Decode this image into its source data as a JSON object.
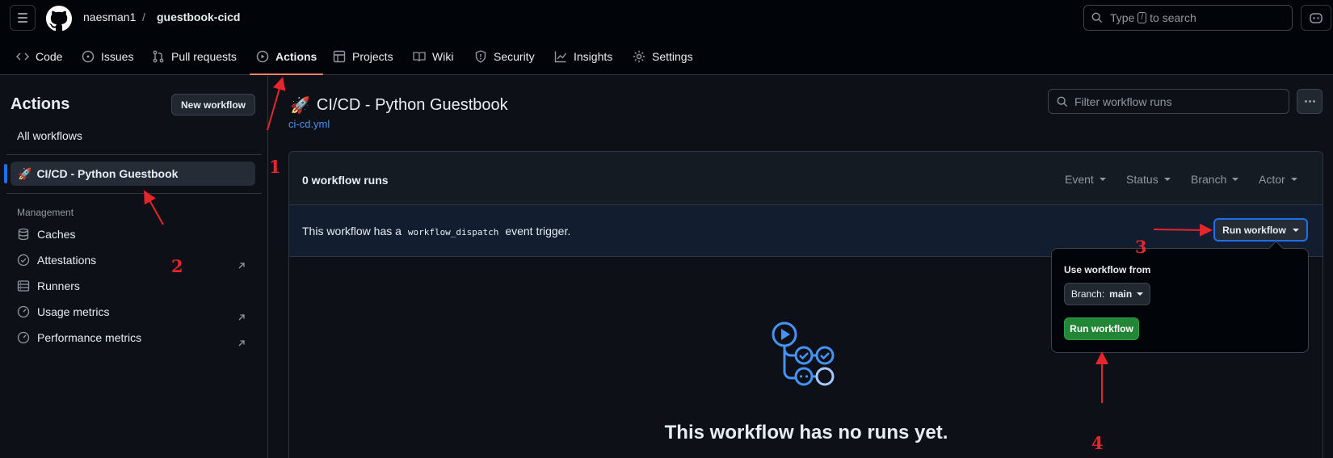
{
  "header": {
    "owner": "naesman1",
    "separator": "/",
    "repo": "guestbook-cicd",
    "search_prefix": "Type",
    "search_key": "/",
    "search_suffix": "to search"
  },
  "tabs": [
    {
      "label": "Code",
      "icon": "code-icon"
    },
    {
      "label": "Issues",
      "icon": "issue-icon"
    },
    {
      "label": "Pull requests",
      "icon": "pull-request-icon"
    },
    {
      "label": "Actions",
      "icon": "play-icon",
      "active": true
    },
    {
      "label": "Projects",
      "icon": "table-icon"
    },
    {
      "label": "Wiki",
      "icon": "book-icon"
    },
    {
      "label": "Security",
      "icon": "shield-icon"
    },
    {
      "label": "Insights",
      "icon": "graph-icon"
    },
    {
      "label": "Settings",
      "icon": "gear-icon"
    }
  ],
  "sidebar": {
    "title": "Actions",
    "new_workflow": "New workflow",
    "all_workflows": "All workflows",
    "workflow_emoji": "🚀",
    "workflow_name": "CI/CD - Python Guestbook",
    "management_heading": "Management",
    "links": [
      {
        "label": "Caches",
        "icon": "database-icon"
      },
      {
        "label": "Attestations",
        "icon": "verified-icon",
        "external": true
      },
      {
        "label": "Runners",
        "icon": "server-icon"
      },
      {
        "label": "Usage metrics",
        "icon": "meter-icon",
        "external": true
      },
      {
        "label": "Performance metrics",
        "icon": "meter-icon",
        "external": true
      }
    ]
  },
  "main": {
    "title_emoji": "🚀",
    "title": "CI/CD - Python Guestbook",
    "file": "ci-cd.yml",
    "filter_placeholder": "Filter workflow runs",
    "runs_count": "0 workflow runs",
    "filters": [
      "Event",
      "Status",
      "Branch",
      "Actor"
    ],
    "trigger_prefix": "This workflow has a",
    "trigger_code": "workflow_dispatch",
    "trigger_suffix": "event trigger.",
    "run_workflow": "Run workflow",
    "empty_text": "This workflow has no runs yet."
  },
  "dropdown": {
    "label": "Use workflow from",
    "branch_prefix": "Branch:",
    "branch_value": "main",
    "run_button": "Run workflow"
  },
  "annotations": {
    "color": "#e5262a",
    "numbers": [
      "1",
      "2",
      "3",
      "4"
    ]
  },
  "colors": {
    "background": "#0d1117",
    "header": "#010409",
    "accent_blue": "#1f6feb",
    "link": "#4493f8",
    "success_green": "#238636",
    "tab_underline": "#f78166"
  }
}
